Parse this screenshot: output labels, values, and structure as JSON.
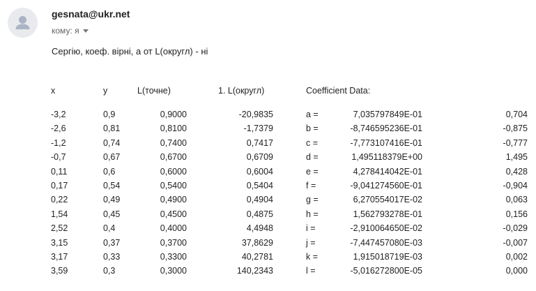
{
  "email": {
    "sender": "gesnata@ukr.net",
    "recipient_label": "кому: я",
    "avatar_icon": "person-icon",
    "dropdown_icon": "caret-down-icon",
    "body": "Сергію, коеф. вірні, а от L(округл) - ні"
  },
  "table": {
    "headers": {
      "x": "x",
      "y": "y",
      "l_exact": "L(точне)",
      "l_rounded": "1. L(округл)",
      "coef_title": "Coefficient Data:"
    },
    "rows": [
      {
        "x": "-3,2",
        "y": "0,9",
        "l_exact": "0,9000",
        "l_rounded": "-20,9835",
        "coef": "a =",
        "coef_value": "7,035797849E-01",
        "coef_short": "0,704"
      },
      {
        "x": "-2,6",
        "y": "0,81",
        "l_exact": "0,8100",
        "l_rounded": "-1,7379",
        "coef": "b =",
        "coef_value": "-8,746595236E-01",
        "coef_short": "-0,875"
      },
      {
        "x": "-1,2",
        "y": "0,74",
        "l_exact": "0,7400",
        "l_rounded": "0,7417",
        "coef": "c =",
        "coef_value": "-7,773107416E-01",
        "coef_short": "-0,777"
      },
      {
        "x": "-0,7",
        "y": "0,67",
        "l_exact": "0,6700",
        "l_rounded": "0,6709",
        "coef": "d =",
        "coef_value": "1,495118379E+00",
        "coef_short": "1,495"
      },
      {
        "x": "0,11",
        "y": "0,6",
        "l_exact": "0,6000",
        "l_rounded": "0,6004",
        "coef": "e =",
        "coef_value": "4,278414042E-01",
        "coef_short": "0,428"
      },
      {
        "x": "0,17",
        "y": "0,54",
        "l_exact": "0,5400",
        "l_rounded": "0,5404",
        "coef": "f =",
        "coef_value": "-9,041274560E-01",
        "coef_short": "-0,904"
      },
      {
        "x": "0,22",
        "y": "0,49",
        "l_exact": "0,4900",
        "l_rounded": "0,4904",
        "coef": "g =",
        "coef_value": "6,270554017E-02",
        "coef_short": "0,063"
      },
      {
        "x": "1,54",
        "y": "0,45",
        "l_exact": "0,4500",
        "l_rounded": "0,4875",
        "coef": "h =",
        "coef_value": "1,562793278E-01",
        "coef_short": "0,156"
      },
      {
        "x": "2,52",
        "y": "0,4",
        "l_exact": "0,4000",
        "l_rounded": "4,4948",
        "coef": "i =",
        "coef_value": "-2,910064650E-02",
        "coef_short": "-0,029"
      },
      {
        "x": "3,15",
        "y": "0,37",
        "l_exact": "0,3700",
        "l_rounded": "37,8629",
        "coef": "j =",
        "coef_value": "-7,447457080E-03",
        "coef_short": "-0,007"
      },
      {
        "x": "3,17",
        "y": "0,33",
        "l_exact": "0,3300",
        "l_rounded": "40,2781",
        "coef": "k =",
        "coef_value": "1,915018719E-03",
        "coef_short": "0,002"
      },
      {
        "x": "3,59",
        "y": "0,3",
        "l_exact": "0,3000",
        "l_rounded": "140,2343",
        "coef": "l =",
        "coef_value": "-5,016272800E-05",
        "coef_short": "0,000"
      }
    ]
  }
}
